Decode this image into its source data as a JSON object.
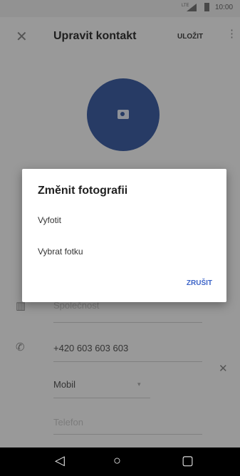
{
  "status_bar": {
    "network": "LTE",
    "time": "10:00"
  },
  "toolbar": {
    "close_icon": "close-icon",
    "title": "Upravit kontakt",
    "save_label": "ULOŽIT",
    "more_icon": "more-vert-icon"
  },
  "avatar": {
    "icon": "camera-icon",
    "color": "#3f5fa3"
  },
  "form": {
    "company_placeholder": "Společnost",
    "phone_value": "+420 603 603 603",
    "phone_type": "Mobil",
    "phone_placeholder": "Telefon"
  },
  "dialog": {
    "title": "Změnit fotografii",
    "option_take": "Vyfotit",
    "option_choose": "Vybrat fotku",
    "cancel": "ZRUŠIT",
    "accent": "#3c64c8"
  },
  "navbar": {
    "back_icon": "back-icon",
    "home_icon": "home-icon",
    "recents_icon": "recents-icon"
  }
}
